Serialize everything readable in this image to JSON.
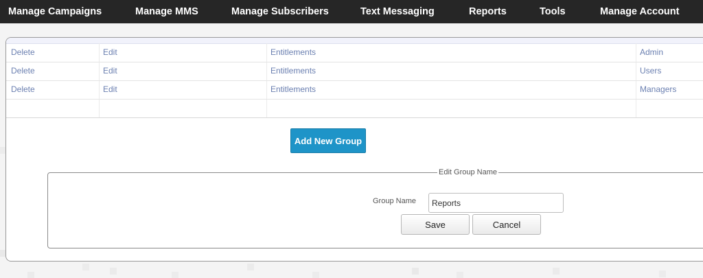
{
  "nav": {
    "items": [
      {
        "label": "Manage Campaigns"
      },
      {
        "label": "Manage MMS"
      },
      {
        "label": "Manage Subscribers"
      },
      {
        "label": "Text Messaging"
      },
      {
        "label": "Reports"
      },
      {
        "label": "Tools"
      },
      {
        "label": "Manage Account"
      }
    ]
  },
  "groups": {
    "rows": [
      {
        "delete": "Delete",
        "edit": "Edit",
        "entitlements": "Entitlements",
        "name": "Admin"
      },
      {
        "delete": "Delete",
        "edit": "Edit",
        "entitlements": "Entitlements",
        "name": "Users"
      },
      {
        "delete": "Delete",
        "edit": "Edit",
        "entitlements": "Entitlements",
        "name": "Managers"
      }
    ],
    "add_button": "Add New Group"
  },
  "edit_form": {
    "legend": "Edit Group Name",
    "group_name_label": "Group Name",
    "group_name_value": "Reports",
    "save_label": "Save",
    "cancel_label": "Cancel"
  },
  "colors": {
    "nav_bg": "#262626",
    "link": "#6a7fb0",
    "primary_button": "#1e94c8"
  }
}
